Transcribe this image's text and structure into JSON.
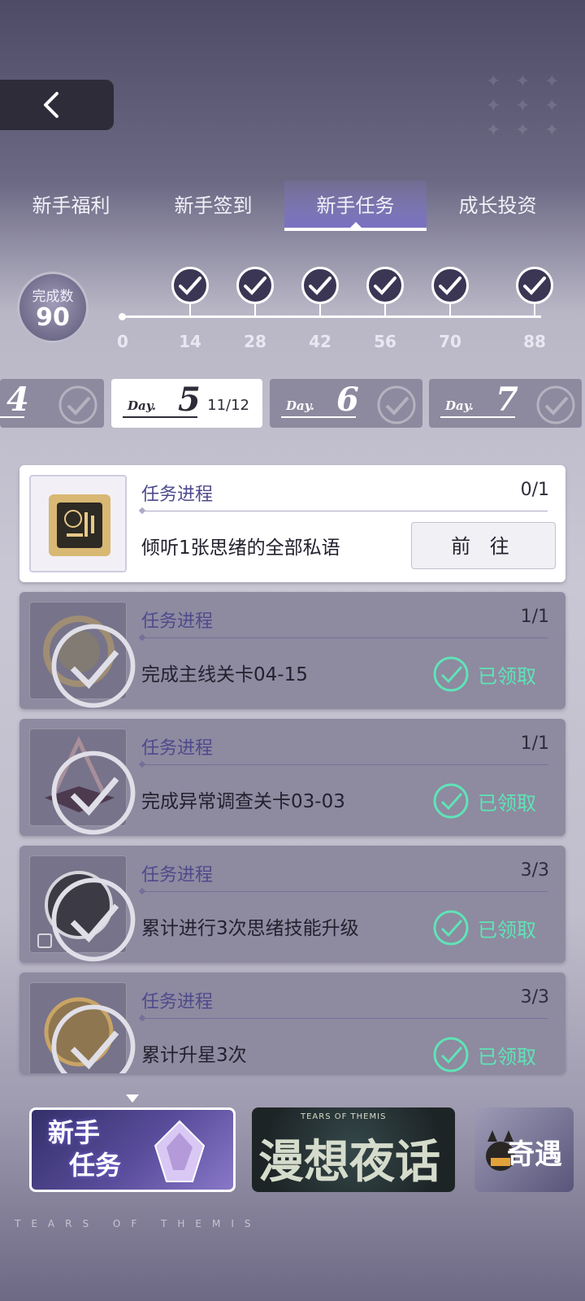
{
  "tabs": [
    {
      "label": "新手福利",
      "active": false
    },
    {
      "label": "新手签到",
      "active": false
    },
    {
      "label": "新手任务",
      "active": true
    },
    {
      "label": "成长投资",
      "active": false
    }
  ],
  "completion": {
    "label": "完成数",
    "value": "90"
  },
  "milestones": [
    "0",
    "14",
    "28",
    "42",
    "56",
    "70",
    "88"
  ],
  "days": [
    {
      "prefix": "",
      "number": "4",
      "active": false,
      "count": ""
    },
    {
      "prefix": "Day.",
      "number": "5",
      "active": true,
      "count": "11/12"
    },
    {
      "prefix": "Day.",
      "number": "6",
      "active": false,
      "count": ""
    },
    {
      "prefix": "Day.",
      "number": "7",
      "active": false,
      "count": ""
    }
  ],
  "tasks": [
    {
      "title": "任务进程",
      "progress": "0/1",
      "desc": "倾听1张思绪的全部私语",
      "action": "前 往",
      "state": "open"
    },
    {
      "title": "任务进程",
      "progress": "1/1",
      "desc": "完成主线关卡04-15",
      "action": "已领取",
      "state": "claimed"
    },
    {
      "title": "任务进程",
      "progress": "1/1",
      "desc": "完成异常调查关卡03-03",
      "action": "已领取",
      "state": "claimed"
    },
    {
      "title": "任务进程",
      "progress": "3/3",
      "desc": "累计进行3次思绪技能升级",
      "action": "已领取",
      "state": "claimed"
    },
    {
      "title": "任务进程",
      "progress": "3/3",
      "desc": "累计升星3次",
      "action": "已领取",
      "state": "claimed"
    }
  ],
  "banners": {
    "b1": {
      "line1": "新手",
      "line2": "任务"
    },
    "b2": {
      "small": "TEARS OF THEMIS",
      "big": "漫想夜话"
    },
    "b3": {
      "text": "奇遇"
    }
  },
  "footer": "TEARS OF THEMIS",
  "colors": {
    "claimed": "#5fe4b6",
    "active_tab": "#7b6fd0",
    "card_open": "#ffffff",
    "card_done": "#8e8aa0"
  },
  "icons": {
    "back": "chevron-left-icon",
    "node": "check-badge-icon",
    "claimed": "check-circle-icon"
  }
}
